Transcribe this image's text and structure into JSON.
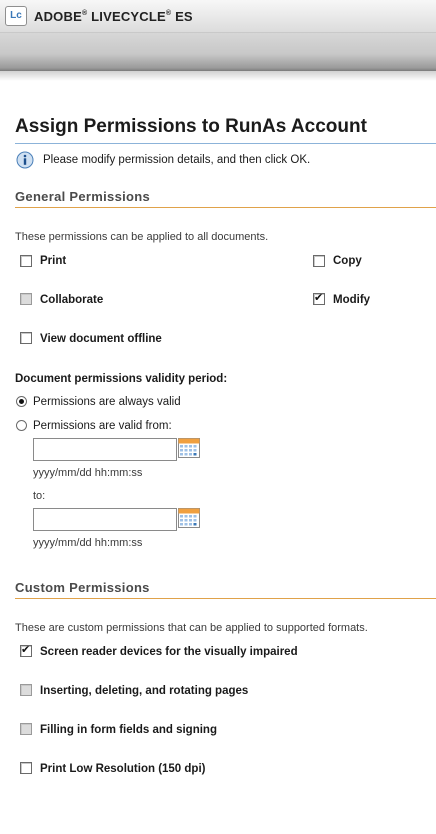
{
  "app": {
    "logo": "Lc",
    "brand_parts": [
      "ADOBE",
      "LIVECYCLE",
      "ES"
    ]
  },
  "page": {
    "title": "Assign Permissions to RunAs Account",
    "info_text": "Please modify permission details, and then click OK."
  },
  "general": {
    "heading": "General Permissions",
    "description": "These permissions can be applied to all documents.",
    "permissions": {
      "print": {
        "label": "Print",
        "checked": false,
        "enabled": true
      },
      "copy": {
        "label": "Copy",
        "checked": false,
        "enabled": true
      },
      "collaborate": {
        "label": "Collaborate",
        "checked": false,
        "enabled": false
      },
      "modify": {
        "label": "Modify",
        "checked": true,
        "enabled": true
      },
      "view_offline": {
        "label": "View document offline",
        "checked": false,
        "enabled": true
      }
    }
  },
  "validity": {
    "heading": "Document permissions validity period:",
    "always_label": "Permissions are always valid",
    "from_label": "Permissions are valid from:",
    "selected": "always",
    "from_value": "",
    "from_hint": "yyyy/mm/dd hh:mm:ss",
    "to_label": "to:",
    "to_value": "",
    "to_hint": "yyyy/mm/dd hh:mm:ss"
  },
  "custom": {
    "heading": "Custom Permissions",
    "description": "These are custom permissions that can be applied to supported formats.",
    "permissions": {
      "screen_reader": {
        "label": "Screen reader devices for the visually impaired",
        "checked": true,
        "enabled": true
      },
      "pages": {
        "label": "Inserting, deleting, and rotating pages",
        "checked": false,
        "enabled": false
      },
      "forms": {
        "label": "Filling in form fields and signing",
        "checked": false,
        "enabled": false
      },
      "low_res": {
        "label": "Print Low Resolution (150 dpi)",
        "checked": false,
        "enabled": true
      }
    }
  },
  "colors": {
    "title_rule": "#8cb3d9",
    "section_rule": "#e0a24a"
  }
}
